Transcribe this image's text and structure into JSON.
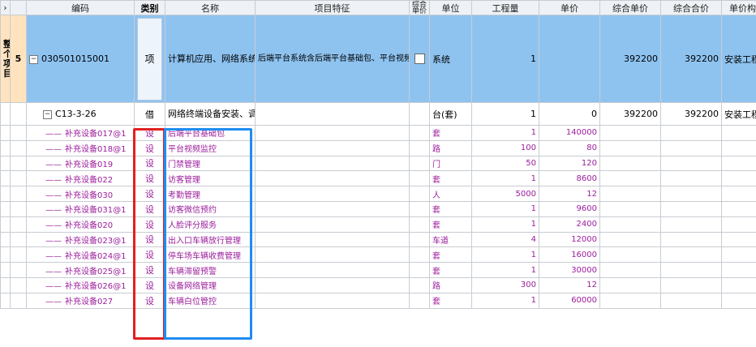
{
  "header": {
    "expand_glyph": "›",
    "code": "编码",
    "type": "类别",
    "name": "名称",
    "features": "项目特征",
    "summary": "综合单价",
    "unit": "单位",
    "quantity": "工程量",
    "price": "单价",
    "comp_price": "综合单价",
    "comp_total": "综合合价",
    "price_build": "单价构成"
  },
  "side_label": "整个项目",
  "main_row": {
    "index": "5",
    "code": "030501015001",
    "type": "项",
    "name": "计算机应用、网络系统系统联调",
    "features": "后端平台系统含后端平台基础包、平台视频监控、门径管理、访客管理、考勤管理、访客微信预约、人脸评分服务、出入口车辆放行管理、停车长车辆收费管理、车辆滞留预警、设备网络关了、车辆白位管控等系统定制服务",
    "unit": "系统",
    "quantity": "1",
    "comp_price": "392200",
    "comp_total": "392200",
    "price_build": "安装工程"
  },
  "quota_row": {
    "code": "C13-3-26",
    "type": "借",
    "name": "网络终端设备安装、调试 工作站",
    "unit": "台(套)",
    "quantity": "1",
    "price": "0",
    "comp_price": "392200",
    "comp_total": "392200",
    "price_build": "安装工程"
  },
  "sub_rows": [
    {
      "code": "补充设备017@1",
      "type": "设",
      "name": "后端平台基础包",
      "unit": "套",
      "quantity": "1",
      "price": "140000"
    },
    {
      "code": "补充设备018@1",
      "type": "设",
      "name": "平台视频监控",
      "unit": "路",
      "quantity": "100",
      "price": "80"
    },
    {
      "code": "补充设备019",
      "type": "设",
      "name": "门禁管理",
      "unit": "门",
      "quantity": "50",
      "price": "120"
    },
    {
      "code": "补充设备022",
      "type": "设",
      "name": "访客管理",
      "unit": "套",
      "quantity": "1",
      "price": "8600"
    },
    {
      "code": "补充设备030",
      "type": "设",
      "name": "考勤管理",
      "unit": "人",
      "quantity": "5000",
      "price": "12"
    },
    {
      "code": "补充设备031@1",
      "type": "设",
      "name": "访客微信预约",
      "unit": "套",
      "quantity": "1",
      "price": "9600"
    },
    {
      "code": "补充设备020",
      "type": "设",
      "name": "人脸评分服务",
      "unit": "套",
      "quantity": "1",
      "price": "2400"
    },
    {
      "code": "补充设备023@1",
      "type": "设",
      "name": "出入口车辆放行管理",
      "unit": "车道",
      "quantity": "4",
      "price": "12000"
    },
    {
      "code": "补充设备024@1",
      "type": "设",
      "name": "停车场车辆收费管理",
      "unit": "套",
      "quantity": "1",
      "price": "16000"
    },
    {
      "code": "补充设备025@1",
      "type": "设",
      "name": "车辆滞留预警",
      "unit": "套",
      "quantity": "1",
      "price": "30000"
    },
    {
      "code": "补充设备026@1",
      "type": "设",
      "name": "设备网络管理",
      "unit": "路",
      "quantity": "300",
      "price": "12"
    },
    {
      "code": "补充设备027",
      "type": "设",
      "name": "车辆白位管控",
      "unit": "套",
      "quantity": "1",
      "price": "60000"
    }
  ],
  "icons": {
    "collapse": "minus-toggle-icon",
    "branch": "tree-branch-icon",
    "checkbox": "checkbox-icon"
  },
  "colors": {
    "selected_row": "#8ec3f0",
    "side_label": "#ffe3bf",
    "sub_text": "#9b1d9b",
    "annotation_red": "#e02020",
    "annotation_blue": "#1f8cf0"
  }
}
